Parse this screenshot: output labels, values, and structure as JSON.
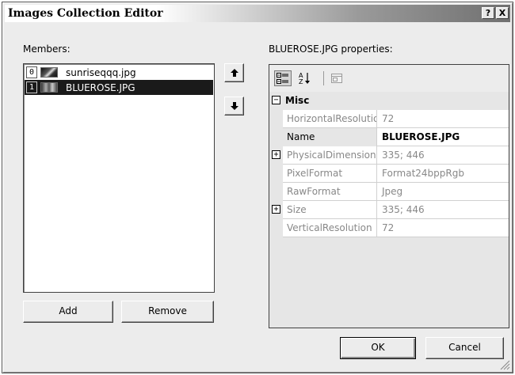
{
  "window": {
    "title": "Images Collection Editor",
    "help_label": "?",
    "close_label": "X"
  },
  "members": {
    "label": "Members:",
    "items": [
      {
        "index": "0",
        "name": "sunriseqqq.jpg",
        "selected": false
      },
      {
        "index": "1",
        "name": "BLUEROSE.JPG",
        "selected": true
      }
    ],
    "add_label": "Add",
    "remove_label": "Remove"
  },
  "properties": {
    "label": "BLUEROSE.JPG properties:",
    "category": "Misc",
    "rows": [
      {
        "name": "HorizontalResolution",
        "value": "72",
        "expandable": false
      },
      {
        "name": "Name",
        "value": "BLUEROSE.JPG",
        "expandable": false,
        "selected": true
      },
      {
        "name": "PhysicalDimension",
        "value": "335; 446",
        "expandable": true
      },
      {
        "name": "PixelFormat",
        "value": "Format24bppRgb",
        "expandable": false
      },
      {
        "name": "RawFormat",
        "value": "Jpeg",
        "expandable": false
      },
      {
        "name": "Size",
        "value": "335; 446",
        "expandable": true
      },
      {
        "name": "VerticalResolution",
        "value": "72",
        "expandable": false
      }
    ],
    "expand_glyph": "+",
    "collapse_glyph": "−"
  },
  "dialog": {
    "ok_label": "OK",
    "cancel_label": "Cancel"
  }
}
